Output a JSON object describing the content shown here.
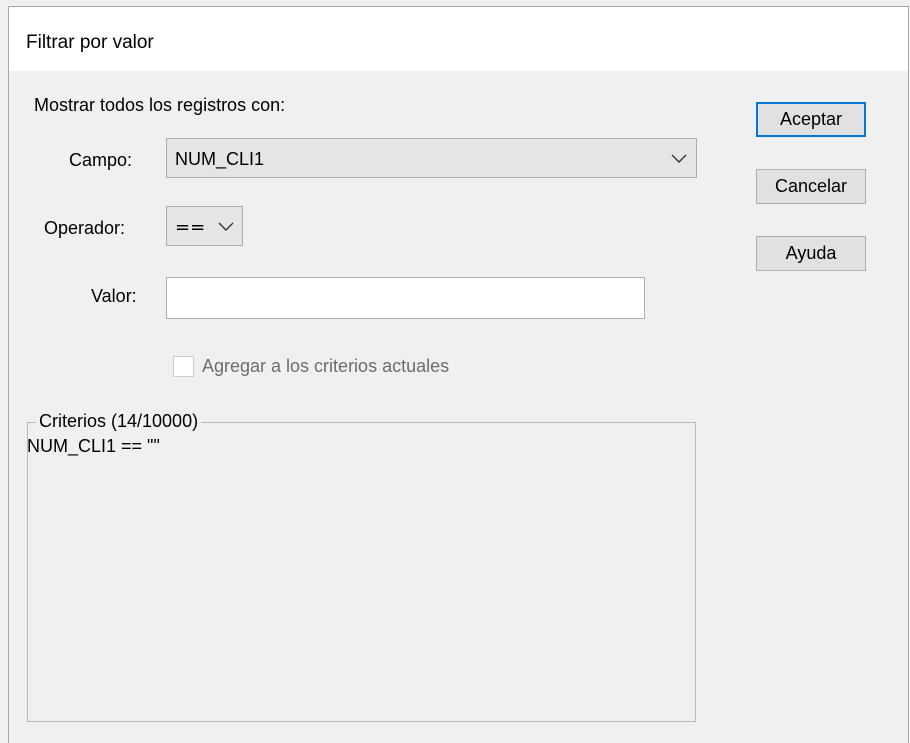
{
  "dialog": {
    "title": "Filtrar por valor",
    "prompt": "Mostrar todos los registros con:"
  },
  "field": {
    "label": "Campo:",
    "value": "NUM_CLI1"
  },
  "operator": {
    "label": "Operador:",
    "value": "=="
  },
  "value_field": {
    "label": "Valor:",
    "value": ""
  },
  "append_checkbox": {
    "label": "Agregar a los criterios actuales",
    "checked": false,
    "enabled": false
  },
  "criteria": {
    "legend": "Criterios (14/10000)",
    "text": "NUM_CLI1 == \"\""
  },
  "buttons": {
    "accept": "Aceptar",
    "cancel": "Cancelar",
    "help": "Ayuda"
  },
  "icons": {
    "field_dropdown": "chevron-down-icon",
    "operator_dropdown": "chevron-down-icon"
  },
  "colors": {
    "default_button_border": "#0078d7",
    "dialog_background": "#f0f0f0",
    "titlebar_background": "#ffffff",
    "disabled_text": "#6d6d6d"
  }
}
